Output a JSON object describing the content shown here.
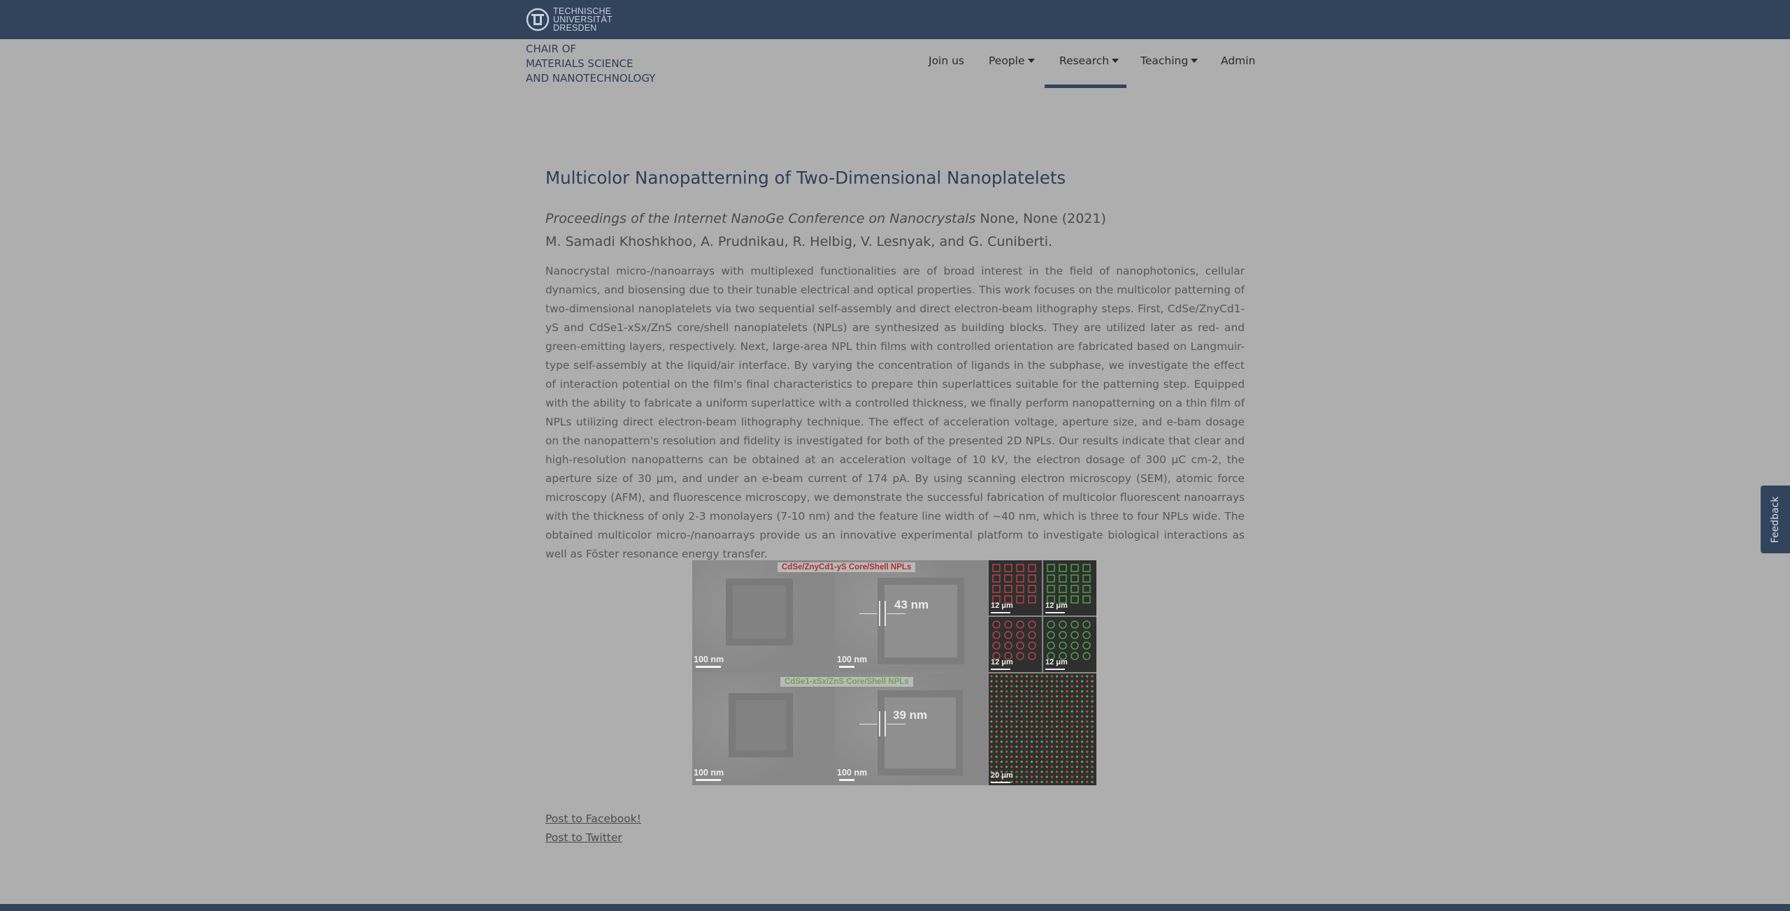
{
  "header": {
    "logo_lines": [
      "TECHNISCHE",
      "UNIVERSITÄT",
      "DRESDEN"
    ],
    "chair_lines": [
      "CHAIR OF",
      "MATERIALS SCIENCE",
      "AND NANOTECHNOLOGY"
    ]
  },
  "nav": {
    "items": [
      {
        "label": "Join us",
        "dropdown": false
      },
      {
        "label": "People",
        "dropdown": true
      },
      {
        "label": "Research",
        "dropdown": true,
        "active": true
      },
      {
        "label": "Teaching",
        "dropdown": true
      },
      {
        "label": "Admin",
        "dropdown": false
      }
    ]
  },
  "article": {
    "title": "Multicolor Nanopatterning of Two-Dimensional Nanoplatelets",
    "journal": "Proceedings of the Internet NanoGe Conference on Nanocrystals",
    "publication_info": " None, None (2021)",
    "authors": "M. Samadi Khoshkhoo, A. Prudnikau, R. Helbig, V. Lesnyak, and G. Cuniberti.",
    "abstract": "Nanocrystal micro-/nanoarrays with multiplexed functionalities are of broad interest in the field of nanophotonics, cellular dynamics, and biosensing due to their tunable electrical and optical properties. This work focuses on the multicolor patterning of two-dimensional nanoplatelets via two sequential self-assembly and direct electron-beam lithography steps. First, CdSe/ZnyCd1-yS and CdSe1-xSx/ZnS core/shell nanoplatelets (NPLs) are synthesized as building blocks. They are utilized later as red- and green-emitting layers, respectively. Next, large-area NPL thin films with controlled orientation are fabricated based on Langmuir-type self-assembly at the liquid/air interface. By varying the concentration of ligands in the subphase, we investigate the effect of interaction potential on the film's final characteristics to prepare thin superlattices suitable for the patterning step. Equipped with the ability to fabricate a uniform superlattice with a controlled thickness, we finally perform nanopatterning on a thin film of NPLs utilizing direct electron-beam lithography technique. The effect of acceleration voltage, aperture size, and e-bam dosage on the nanopattern's resolution and fidelity is investigated for both of the presented 2D NPLs. Our results indicate that clear and high-resolution nanopatterns can be obtained at an acceleration voltage of 10 kV, the electron dosage of 300 μC cm-2, the aperture size of 30 μm, and under an e-beam current of 174 pA. By using scanning electron microscopy (SEM), atomic force microscopy (AFM), and fluorescence microscopy, we demonstrate the successful fabrication of multicolor fluorescent nanoarrays with the thickness of only 2-3 monolayers (7-10 nm) and the feature line width of ~40 nm, which is three to four NPLs wide. The obtained multicolor micro-/nanoarrays provide us an innovative experimental platform to investigate biological interactions as well as Föster resonance energy transfer."
  },
  "figure": {
    "label_red": "CdSe/ZnyCd1-yS Core/Shell NPLs",
    "label_green": "CdSe1-xSx/ZnS Core/Shell NPLs",
    "scale_100nm": "100 nm",
    "measure_top": "43 nm",
    "measure_bottom": "39 nm",
    "scale_12um": "12 μm",
    "scale_20um": "20 μm",
    "red_color": "#c8464a",
    "green_color": "#4fb24a"
  },
  "share": {
    "facebook": "Post to Facebook!",
    "twitter": "Post to Twitter"
  },
  "feedback": {
    "label": "Feedback"
  }
}
